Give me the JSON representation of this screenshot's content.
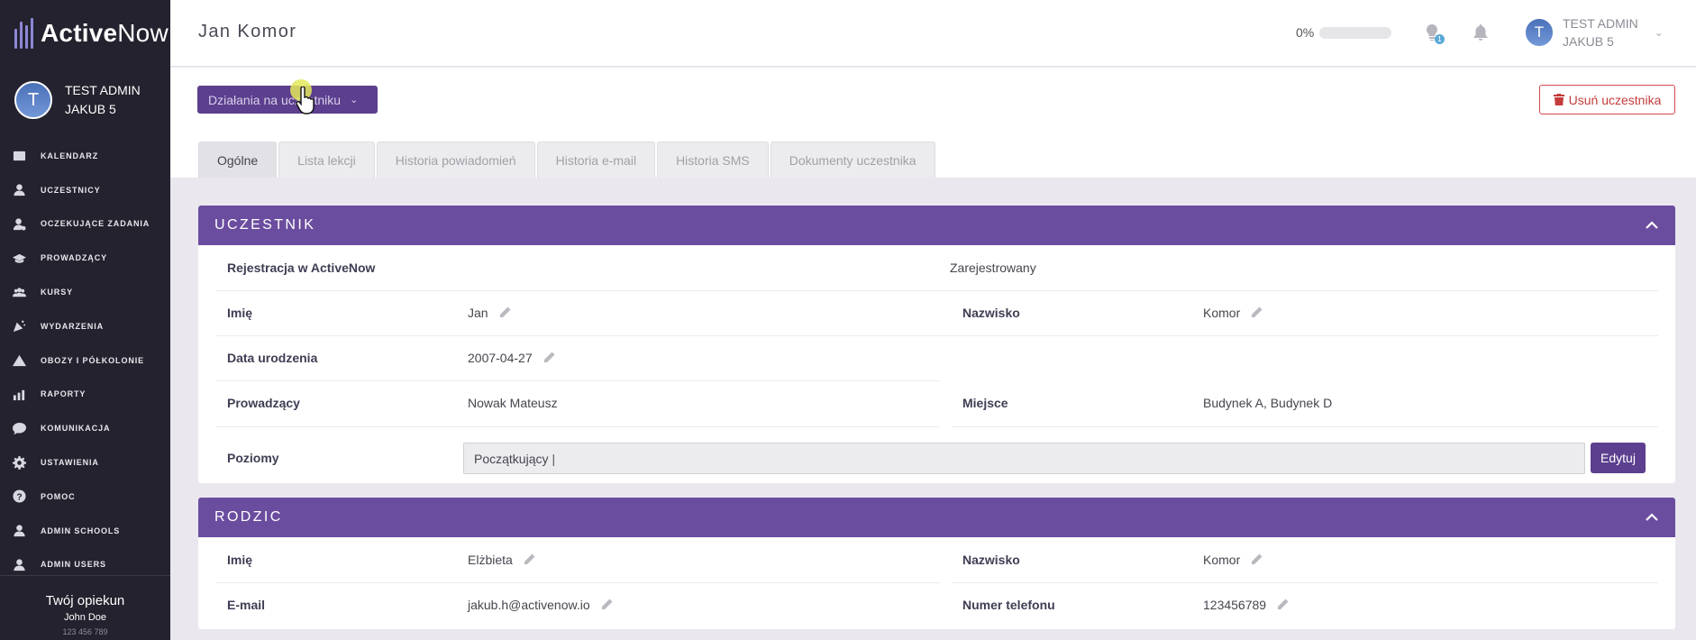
{
  "app": {
    "brand_part1": "Active",
    "brand_part2": "Now"
  },
  "sidebar": {
    "user_name_line1": "TEST ADMIN",
    "user_name_line2": "JAKUB 5",
    "avatar_letter": "T",
    "items": [
      {
        "label": "KALENDARZ",
        "icon": "calendar-icon"
      },
      {
        "label": "UCZESTNICY",
        "icon": "user-icon"
      },
      {
        "label": "OCZEKUJĄCE ZADANIA",
        "icon": "user-clock-icon"
      },
      {
        "label": "PROWADZĄCY",
        "icon": "graduation-cap-icon"
      },
      {
        "label": "KURSY",
        "icon": "users-icon"
      },
      {
        "label": "WYDARZENIA",
        "icon": "party-icon"
      },
      {
        "label": "OBOZY I PÓŁKOLONIE",
        "icon": "mountain-icon"
      },
      {
        "label": "RAPORTY",
        "icon": "chart-icon"
      },
      {
        "label": "KOMUNIKACJA",
        "icon": "chat-icon"
      },
      {
        "label": "USTAWIENIA",
        "icon": "gear-icon"
      },
      {
        "label": "POMOC",
        "icon": "help-icon"
      },
      {
        "label": "ADMIN SCHOOLS",
        "icon": "user-icon"
      },
      {
        "label": "ADMIN USERS",
        "icon": "user-icon"
      }
    ],
    "guardian": {
      "title": "Twój opiekun",
      "name": "John Doe",
      "phone": "123 456 789"
    }
  },
  "topbar": {
    "page_title": "Jan Komor",
    "progress_label": "0%",
    "progress_value": 0,
    "lightbulb_badge": "1",
    "user_line1": "TEST ADMIN",
    "user_line2": "JAKUB 5",
    "avatar_letter": "T"
  },
  "actions": {
    "actions_label": "Działania na uczestniku",
    "delete_label": "Usuń uczestnika"
  },
  "tabs": [
    {
      "label": "Ogólne",
      "active": true
    },
    {
      "label": "Lista lekcji",
      "active": false
    },
    {
      "label": "Historia powiadomień",
      "active": false
    },
    {
      "label": "Historia e-mail",
      "active": false
    },
    {
      "label": "Historia SMS",
      "active": false
    },
    {
      "label": "Dokumenty uczestnika",
      "active": false
    }
  ],
  "participant": {
    "title": "UCZESTNIK",
    "registration_label": "Rejestracja w ActiveNow",
    "registration_value": "Zarejestrowany",
    "first_name_label": "Imię",
    "first_name": "Jan",
    "last_name_label": "Nazwisko",
    "last_name": "Komor",
    "birth_label": "Data urodzenia",
    "birth_date": "2007-04-27",
    "instructor_label": "Prowadzący",
    "instructor": "Nowak Mateusz",
    "place_label": "Miejsce",
    "place": "Budynek A, Budynek D",
    "levels_label": "Poziomy",
    "levels_value": "Początkujący",
    "edit_label": "Edytuj"
  },
  "parent": {
    "title": "RODZIC",
    "first_name_label": "Imię",
    "first_name": "Elżbieta",
    "last_name_label": "Nazwisko",
    "last_name": "Komor",
    "email_label": "E-mail",
    "email": "jakub.h@activenow.io",
    "phone_label": "Numer telefonu",
    "phone": "123456789"
  }
}
